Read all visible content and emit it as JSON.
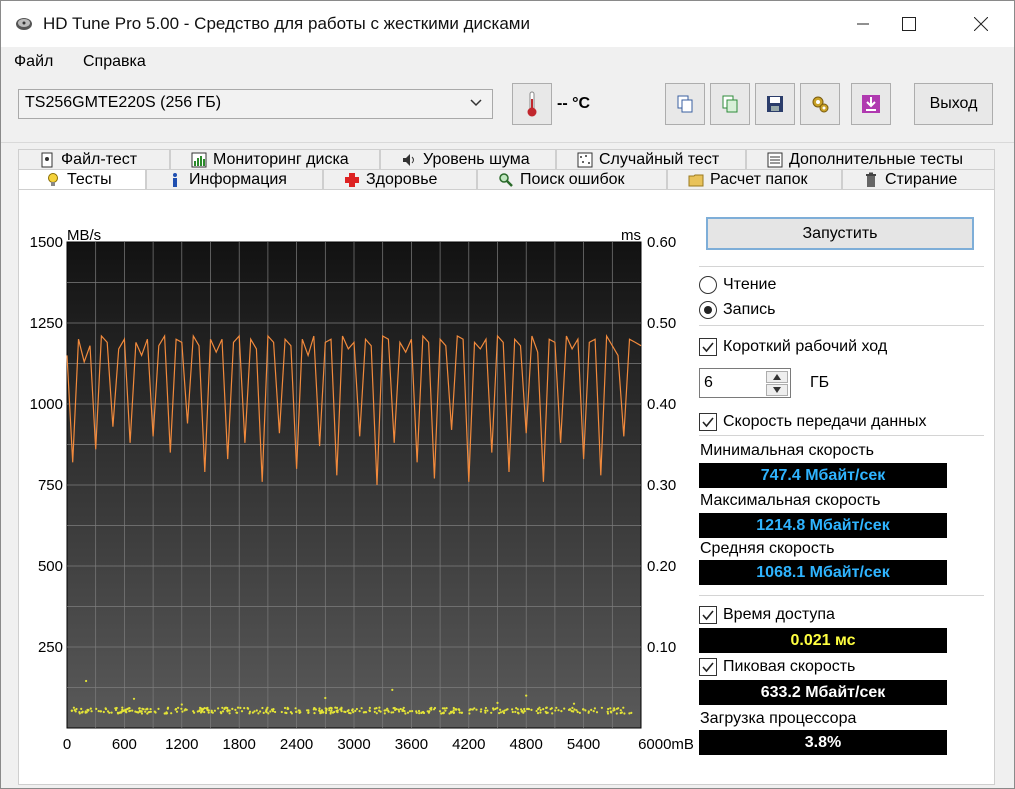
{
  "window": {
    "title": "HD Tune Pro 5.00 - Средство для работы с жесткими дисками",
    "minimize_icon": "minimize-icon",
    "maximize_icon": "maximize-icon",
    "close_icon": "close-icon"
  },
  "menu": {
    "file": "Файл",
    "help": "Справка"
  },
  "toolbar": {
    "drive": "TS256GMTE220S (256 ГБ)",
    "temperature": "-- °C",
    "exit": "Выход"
  },
  "tabs_back": [
    "Файл-тест",
    "Мониторинг диска",
    "Уровень шума",
    "Случайный тест",
    "Дополнительные тесты"
  ],
  "tabs_front": [
    "Тесты",
    "Информация",
    "Здоровье",
    "Поиск ошибок",
    "Расчет папок",
    "Стирание"
  ],
  "controls": {
    "start": "Запустить",
    "read": "Чтение",
    "write": "Запись",
    "short_stroke": "Короткий рабочий ход",
    "short_stroke_value": "6",
    "short_stroke_unit": "ГБ",
    "transfer_rate": "Скорость передачи данных",
    "min_label": "Минимальная скорость",
    "min_value": "747.4 Мбайт/сек",
    "max_label": "Максимальная скорость",
    "max_value": "1214.8 Мбайт/сек",
    "avg_label": "Средняя скорость",
    "avg_value": "1068.1 Мбайт/сек",
    "access_label": "Время доступа",
    "access_value": "0.021 мс",
    "burst_label": "Пиковая скорость",
    "burst_value": "633.2 Мбайт/сек",
    "cpu_label": "Загрузка процессора",
    "cpu_value": "3.8%"
  },
  "colors": {
    "transfer_line": "#f28a3c",
    "access_points": "#e4e437",
    "value_blue": "#2fb4ff",
    "value_yellow": "#ffff40",
    "value_white": "#ffffff"
  },
  "chart_data": {
    "type": "line",
    "ylabel_left": "MB/s",
    "ylabel_right": "ms",
    "xlabel_unit": "mB",
    "xlim": [
      0,
      6000
    ],
    "ylim_left": [
      0,
      1500
    ],
    "ylim_right": [
      0,
      0.6
    ],
    "x_ticks": [
      "0",
      "600",
      "1200",
      "1800",
      "2400",
      "3000",
      "3600",
      "4200",
      "4800",
      "5400",
      "6000mB"
    ],
    "y_ticks_left": [
      "1500",
      "1250",
      "1000",
      "750",
      "500",
      "250"
    ],
    "y_ticks_right": [
      "0.60",
      "0.50",
      "0.40",
      "0.30",
      "0.20",
      "0.10"
    ],
    "series": [
      {
        "name": "Скорость передачи данных",
        "x": [
          0,
          60,
          120,
          180,
          240,
          300,
          360,
          420,
          480,
          540,
          600,
          660,
          720,
          780,
          840,
          900,
          960,
          1020,
          1080,
          1140,
          1200,
          1260,
          1320,
          1380,
          1440,
          1500,
          1560,
          1620,
          1680,
          1740,
          1800,
          1860,
          1920,
          1980,
          2040,
          2100,
          2160,
          2220,
          2280,
          2340,
          2400,
          2460,
          2520,
          2580,
          2640,
          2700,
          2760,
          2820,
          2880,
          2940,
          3000,
          3060,
          3120,
          3180,
          3240,
          3300,
          3360,
          3420,
          3480,
          3540,
          3600,
          3660,
          3720,
          3780,
          3840,
          3900,
          3960,
          4020,
          4080,
          4140,
          4200,
          4260,
          4320,
          4380,
          4440,
          4500,
          4560,
          4620,
          4680,
          4740,
          4800,
          4860,
          4920,
          4980,
          5040,
          5100,
          5160,
          5220,
          5280,
          5340,
          5400,
          5460,
          5520,
          5580,
          5640,
          5700,
          5760,
          5820,
          5880,
          5940,
          6000
        ],
        "values": [
          1150,
          820,
          1200,
          1130,
          1180,
          860,
          1210,
          1190,
          930,
          1170,
          1200,
          880,
          1190,
          1150,
          1200,
          900,
          1180,
          1210,
          850,
          1200,
          1190,
          940,
          1210,
          1180,
          790,
          1200,
          1160,
          1200,
          830,
          1190,
          1210,
          880,
          1200,
          1170,
          760,
          1210,
          1190,
          910,
          1200,
          1180,
          800,
          1200,
          1150,
          1210,
          870,
          1190,
          1200,
          780,
          1210,
          1170,
          1190,
          900,
          1200,
          1180,
          750,
          1210,
          1200,
          880,
          1190,
          1160,
          1200,
          820,
          1210,
          1190,
          770,
          1200,
          1180,
          920,
          1210,
          1200,
          760,
          1190,
          1170,
          1200,
          850,
          1210,
          1190,
          790,
          1200,
          1180,
          910,
          1210,
          1160,
          760,
          1200,
          1190,
          880,
          1210,
          1170,
          1200,
          830,
          1190,
          1200,
          780,
          1210,
          1180,
          1150,
          900,
          1200,
          1190,
          1180
        ]
      },
      {
        "name": "Время доступа",
        "type": "scatter",
        "values_ms": [
          0.021
        ]
      }
    ]
  }
}
